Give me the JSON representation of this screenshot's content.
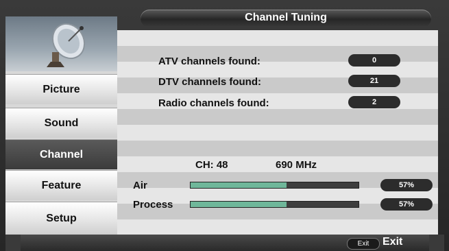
{
  "window": {
    "title": "Channel Tuning"
  },
  "sidebar": {
    "logo_icon": "satellite-dish-icon",
    "items": [
      {
        "label": "Picture",
        "active": false
      },
      {
        "label": "Sound",
        "active": false
      },
      {
        "label": "Channel",
        "active": true
      },
      {
        "label": "Feature",
        "active": false
      },
      {
        "label": "Setup",
        "active": false
      }
    ]
  },
  "tuning": {
    "atv": {
      "label": "ATV channels found:",
      "value": "0"
    },
    "dtv": {
      "label": "DTV channels found:",
      "value": "21"
    },
    "radio": {
      "label": "Radio channels found:",
      "value": "2"
    },
    "channel": "CH: 48",
    "frequency": "690 MHz",
    "air": {
      "label": "Air",
      "percent_text": "57%",
      "fraction": 0.57
    },
    "process": {
      "label": "Process",
      "percent_text": "57%",
      "fraction": 0.57
    }
  },
  "footer": {
    "exit_key": "Exit",
    "exit_label": "Exit"
  },
  "colors": {
    "progress_fill": "#6fb79a",
    "active_item": "#4a4a4a"
  }
}
